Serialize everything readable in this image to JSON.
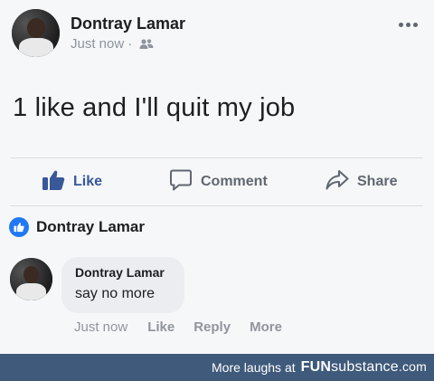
{
  "post": {
    "author": "Dontray Lamar",
    "timestamp": "Just now",
    "separator": "·",
    "audience_icon": "friends-icon",
    "text": "1 like and I'll quit my job",
    "more_icon": "more-dots-icon"
  },
  "actions": {
    "like_label": "Like",
    "comment_label": "Comment",
    "share_label": "Share"
  },
  "reactions": {
    "reactor": "Dontray Lamar",
    "reaction_icon": "thumbs-up-icon"
  },
  "comment": {
    "author": "Dontray Lamar",
    "text": "say no more",
    "timestamp": "Just now",
    "like_label": "Like",
    "reply_label": "Reply",
    "more_label": "More"
  },
  "footer": {
    "text": "More laughs at",
    "logo_fun": "FUN",
    "logo_substance": "substance",
    "logo_domain": ".com"
  },
  "colors": {
    "accent": "#385898",
    "reaction_blue": "#2078f4",
    "footer_bg": "#3f5a7a",
    "muted": "#8d949e"
  }
}
